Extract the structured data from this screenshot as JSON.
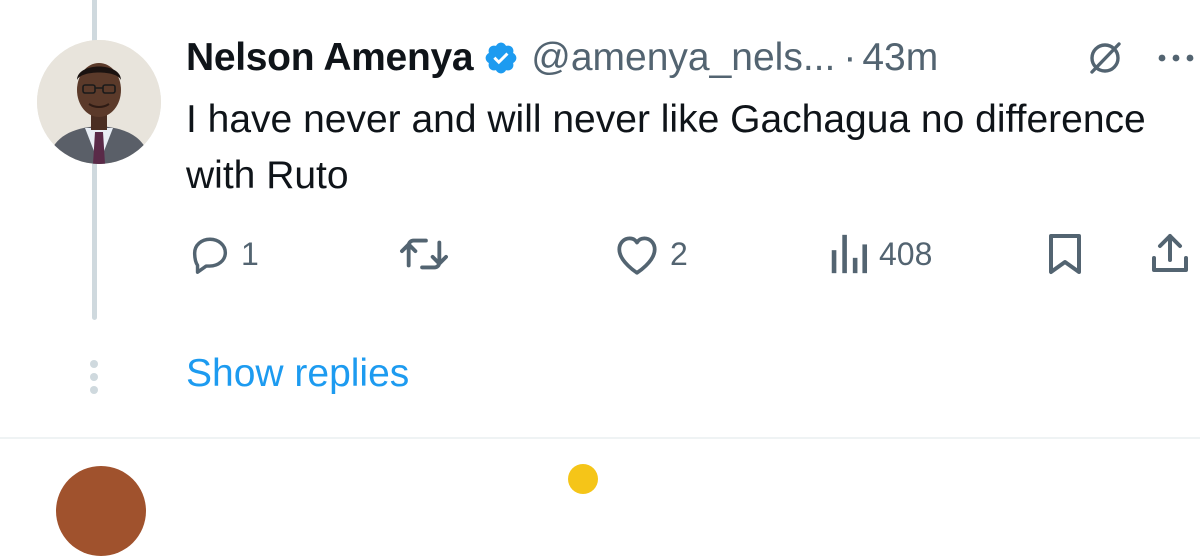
{
  "tweet": {
    "author_name": "Nelson Amenya",
    "handle": "@amenya_nels...",
    "separator": "·",
    "time": "43m",
    "text": "I have never and will never like Gachagua no difference with Ruto",
    "icons": {
      "verified": "verified-badge-icon",
      "grok": "grok-icon",
      "more": "more-icon"
    }
  },
  "actions": {
    "reply_count": "1",
    "repost_count": "",
    "like_count": "2",
    "views_count": "408"
  },
  "thread": {
    "show_replies_label": "Show replies"
  },
  "colors": {
    "accent": "#1d9bf0",
    "secondary_text": "#536471",
    "primary_text": "#0f1419",
    "thread_line": "#cfd9de"
  }
}
